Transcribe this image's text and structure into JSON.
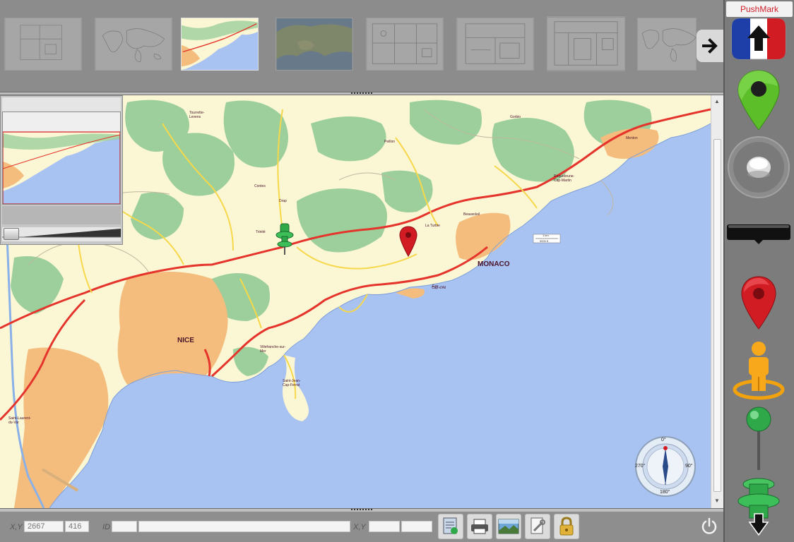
{
  "app": {
    "name": "PushMark"
  },
  "thumbnails": [
    {
      "label": "floor-plan-1"
    },
    {
      "label": "world-map-outline"
    },
    {
      "label": "cote-azur-road-map"
    },
    {
      "label": "europe-satellite"
    },
    {
      "label": "floor-plan-2"
    },
    {
      "label": "floor-plan-3"
    },
    {
      "label": "floor-plan-4"
    },
    {
      "label": "world-map-outline-2"
    }
  ],
  "map": {
    "cities": {
      "nice": "NICE",
      "monaco": "MONACO",
      "villefranche": "Villefranche-sur-Mer",
      "saint_jean": "Saint-Jean-Cap-Ferrat",
      "la_turbie": "La Turbie",
      "roquebrune": "Roquebrune-Cap-Martin",
      "menton": "Menton",
      "tourrette": "Tourrette-Levens",
      "peillon": "Peillon",
      "contes": "Contes",
      "drap": "Drap",
      "trinite": "Trinité",
      "eze": "Èze",
      "gorbio": "Gorbio",
      "saint_laurent": "Saint-Laurent-du-Var",
      "beausoleil": "Beausoleil",
      "cap_dail": "Cap-d'Ail"
    },
    "scale_top": "1 km",
    "scale_bottom": "5000 ft"
  },
  "compass": {
    "n": "0°",
    "e": "90°",
    "s": "180°",
    "w": "270°"
  },
  "statusbar": {
    "xy_label": "X,Y",
    "x_value": "2667",
    "y_value": "416",
    "id_label": "ID",
    "id_value": "",
    "xy2_label": "X,Y",
    "x2_value": "",
    "y2_value": ""
  },
  "colors": {
    "sea": "#a8c2f2",
    "land": "#fbf6d4",
    "forest": "#9ccf9b",
    "urban": "#f4bd7e",
    "road_red": "#e4342b",
    "road_yellow": "#f6d84a",
    "pin_red": "#d21c24",
    "pin_green": "#2fa84a"
  }
}
